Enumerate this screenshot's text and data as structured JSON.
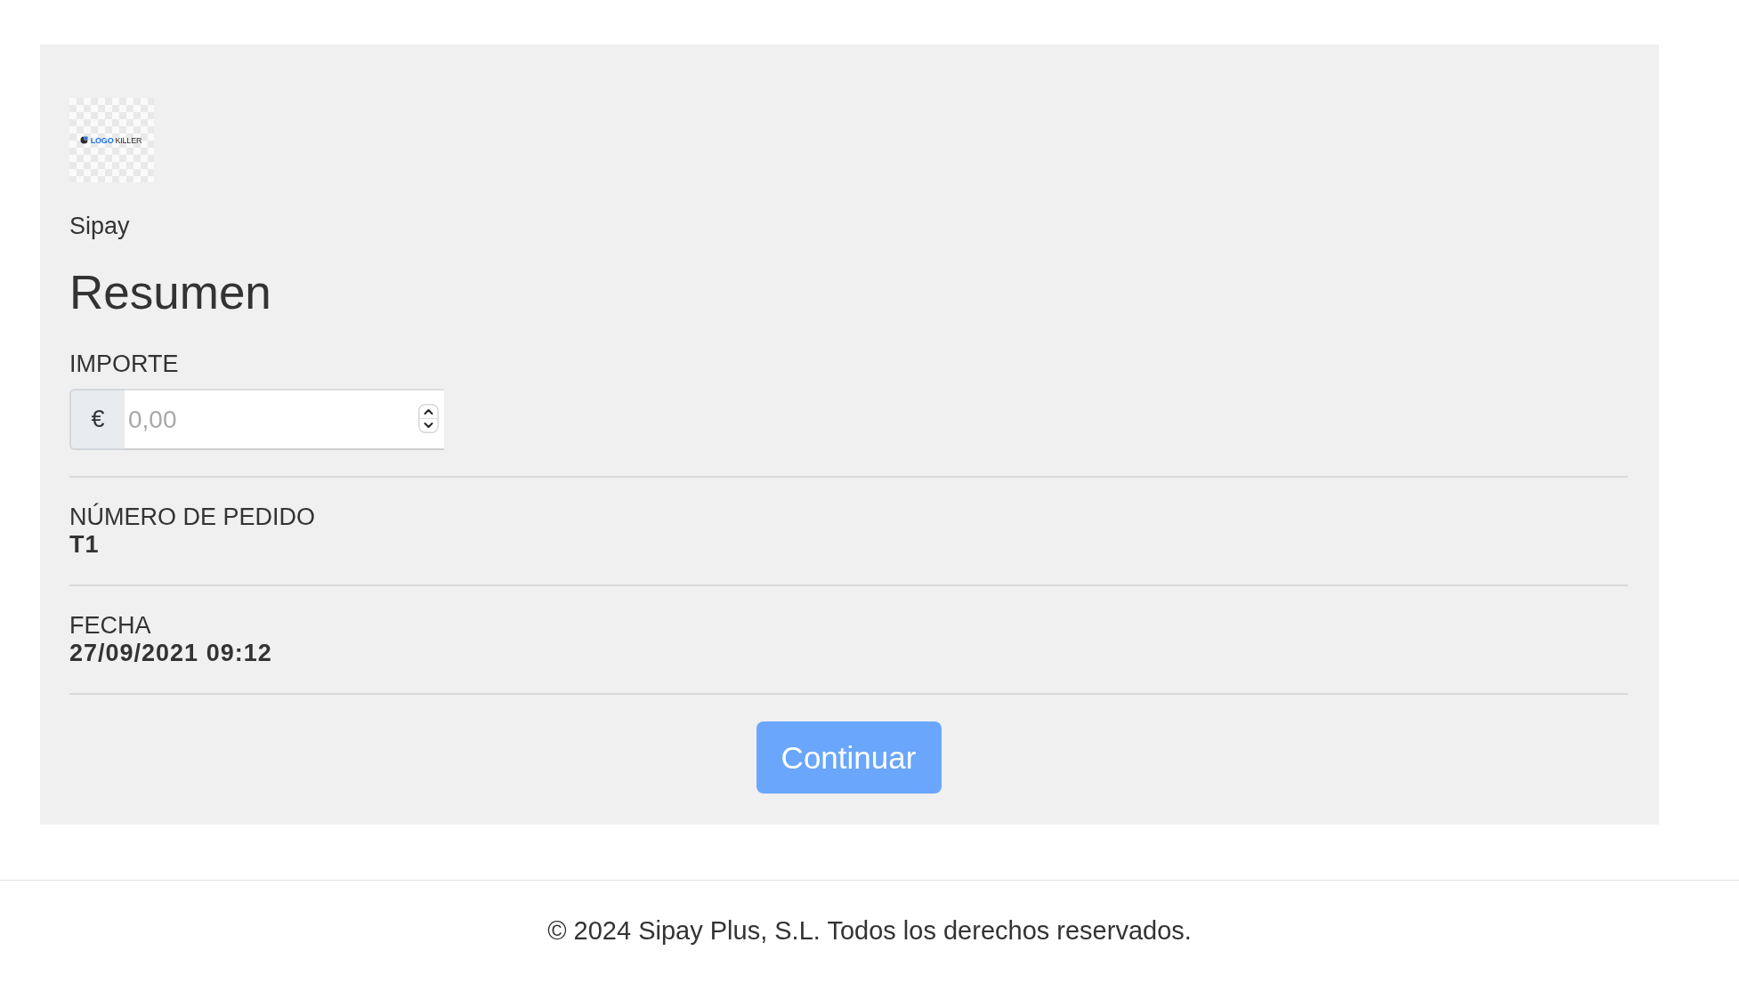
{
  "logo": {
    "words": [
      {
        "text": "LOGO",
        "accent": true
      },
      {
        "text": "KILLER",
        "accent": false
      }
    ]
  },
  "merchant": "Sipay",
  "title": "Resumen",
  "amount": {
    "label": "IMPORTE",
    "currency": "€",
    "placeholder": "0,00"
  },
  "details": [
    {
      "label": "NÚMERO DE PEDIDO",
      "value": "T1"
    },
    {
      "label": "FECHA",
      "value": "27/09/2021 09:12"
    }
  ],
  "button": {
    "label": "Continuar"
  },
  "footer": "© 2024 Sipay Plus, S.L. Todos los derechos reservados."
}
